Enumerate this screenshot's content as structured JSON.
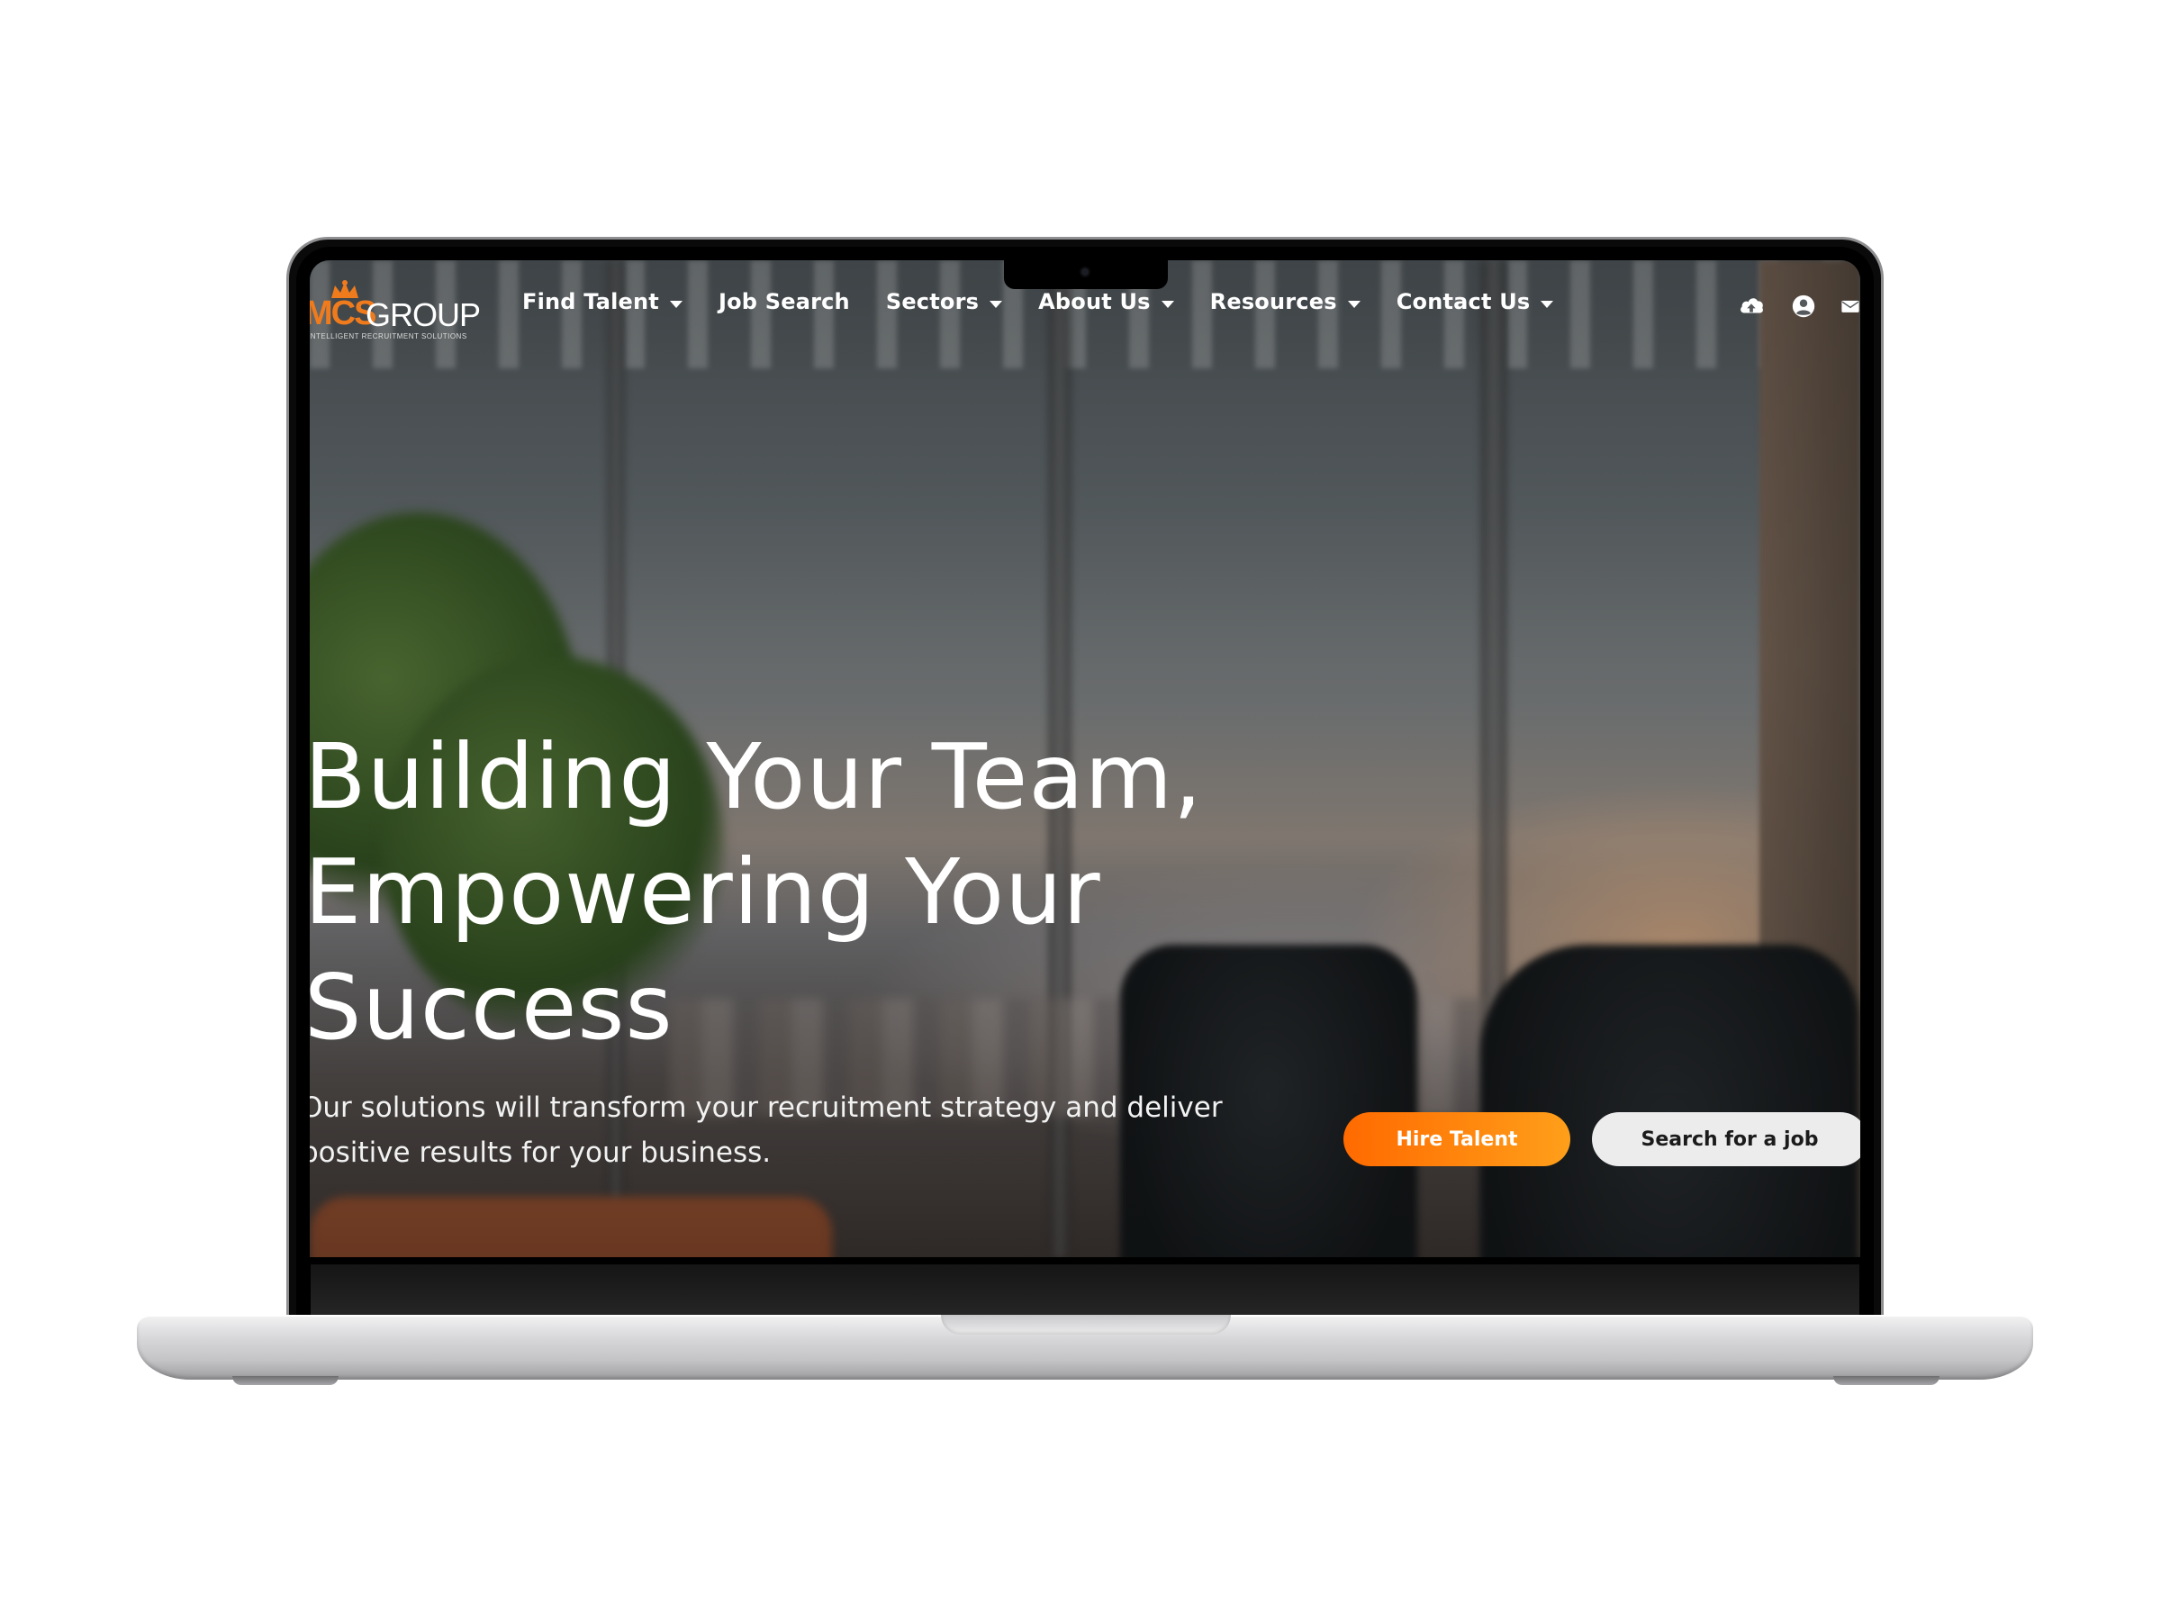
{
  "brand": {
    "logo_primary": "MCS",
    "logo_secondary": "GROUP",
    "tagline": "INTELLIGENT RECRUITMENT SOLUTIONS",
    "accent_color": "#f07b1d"
  },
  "nav": {
    "items": [
      {
        "label": "Find Talent",
        "has_dropdown": true
      },
      {
        "label": "Job Search",
        "has_dropdown": false
      },
      {
        "label": "Sectors",
        "has_dropdown": true
      },
      {
        "label": "About Us",
        "has_dropdown": true
      },
      {
        "label": "Resources",
        "has_dropdown": true
      },
      {
        "label": "Contact Us",
        "has_dropdown": true
      }
    ],
    "icons": [
      "cloud-upload-icon",
      "user-account-icon",
      "mail-icon"
    ]
  },
  "hero": {
    "title_lines": [
      "Building Your Team,",
      "Empowering Your",
      "Success"
    ],
    "subtitle_lines": [
      "Our solutions will transform your recruitment strategy and deliver",
      "positive results for your business."
    ],
    "primary_button": "Hire Talent",
    "secondary_button": "Search for a job",
    "primary_button_colors": [
      "#ff6a00",
      "#ff9f1a"
    ],
    "secondary_button_color": "#ececed"
  }
}
